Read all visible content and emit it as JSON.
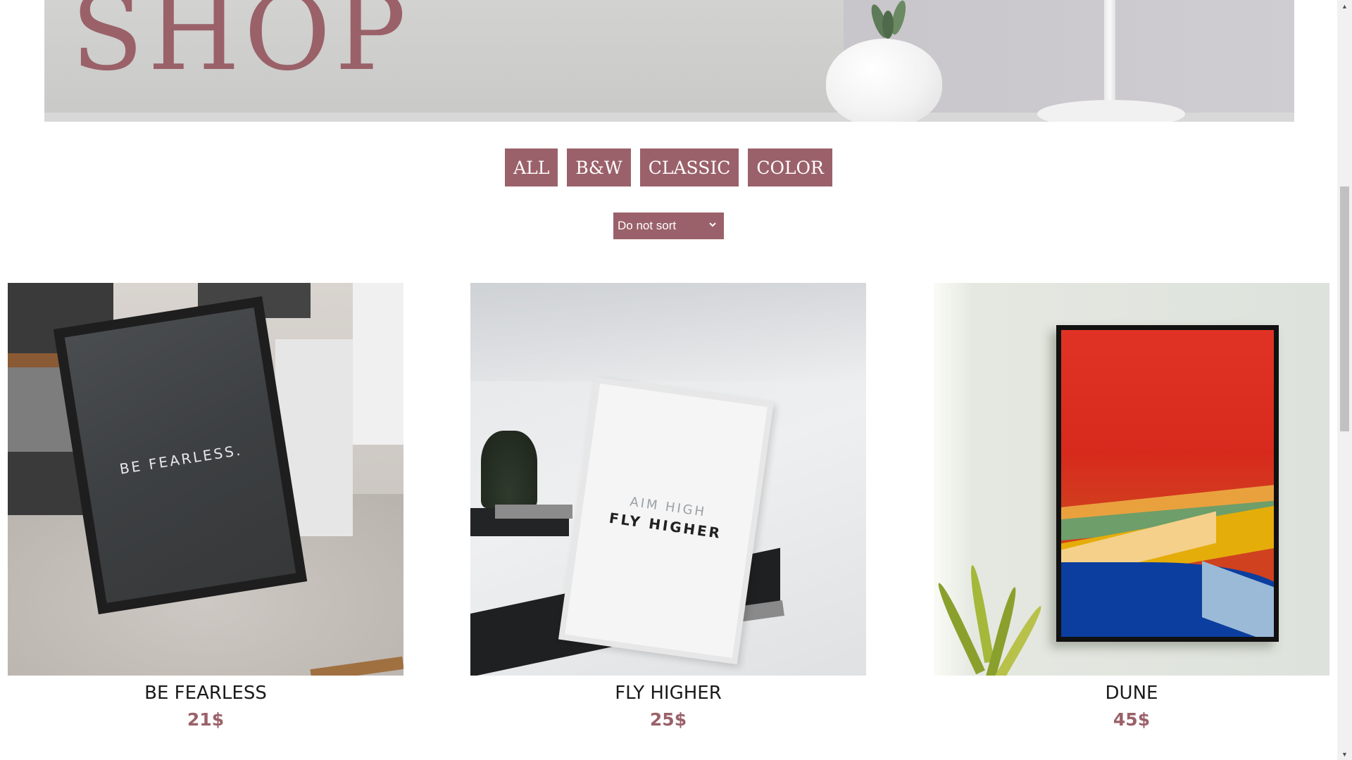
{
  "hero": {
    "title": "SHOP"
  },
  "filters": [
    {
      "label": "ALL"
    },
    {
      "label": "B&W"
    },
    {
      "label": "CLASSIC"
    },
    {
      "label": "COLOR"
    }
  ],
  "sort": {
    "selected": "Do not sort"
  },
  "products": [
    {
      "name": "BE FEARLESS",
      "price": "21$",
      "poster_text": "BE FEARLESS."
    },
    {
      "name": "FLY HIGHER",
      "price": "25$",
      "poster_line1": "AIM HIGH",
      "poster_line2": "FLY HIGHER"
    },
    {
      "name": "DUNE",
      "price": "45$"
    }
  ],
  "colors": {
    "accent": "#9b616a",
    "title": "#9a6169"
  }
}
